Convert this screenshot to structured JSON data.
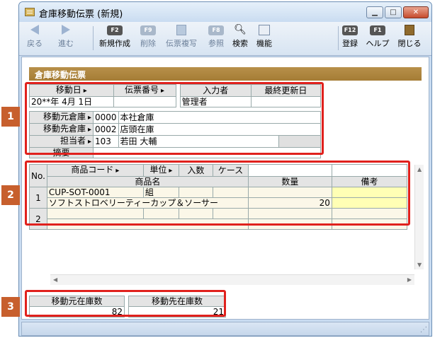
{
  "window": {
    "title": "倉庫移動伝票 (新規)",
    "min": "▁",
    "max": "□",
    "close": "✕"
  },
  "toolbar": {
    "back": "戻る",
    "forward": "進む",
    "new": {
      "key": "F2",
      "label": "新規作成"
    },
    "delete": {
      "key": "F9",
      "label": "削除"
    },
    "copy": {
      "label": "伝票複写"
    },
    "ref": {
      "key": "F8",
      "label": "参照"
    },
    "search": {
      "label": "検索"
    },
    "func": {
      "label": "機能"
    },
    "register": {
      "key": "F12",
      "label": "登録"
    },
    "help": {
      "key": "F1",
      "label": "ヘルプ"
    },
    "close": {
      "label": "閉じる"
    }
  },
  "doc": {
    "header": "倉庫移動伝票"
  },
  "section1": {
    "move_date_label": "移動日",
    "slip_no_label": "伝票番号",
    "entered_by_label": "入力者",
    "last_update_label": "最終更新日",
    "move_date_value": "20**年 4月 1日",
    "slip_no_value": "",
    "entered_by_value": "管理者",
    "last_update_value": "",
    "from_wh_label": "移動元倉庫",
    "from_wh_code": "0000",
    "from_wh_name": "本社倉庫",
    "to_wh_label": "移動先倉庫",
    "to_wh_code": "0002",
    "to_wh_name": "店頭在庫",
    "staff_label": "担当者",
    "staff_code": "103",
    "staff_name": "若田 大輔",
    "memo_label": "摘要",
    "memo_value": ""
  },
  "section2": {
    "h_no": "No.",
    "h_code": "商品コード",
    "h_unit": "単位",
    "h_count": "入数",
    "h_case": "ケース",
    "h_name": "商品名",
    "h_qty": "数量",
    "h_note": "備考",
    "rows": [
      {
        "no": "1",
        "code": "CUP-SOT-0001",
        "unit": "組",
        "name": "ソフトストロベリーティーカップ＆ソーサー",
        "qty": "20",
        "note": ""
      },
      {
        "no": "2",
        "code": "",
        "unit": "",
        "name": "",
        "qty": "",
        "note": ""
      }
    ]
  },
  "section3": {
    "from_stock_label": "移動元在庫数",
    "to_stock_label": "移動先在庫数",
    "from_stock_value": "82",
    "to_stock_value": "21"
  },
  "badges": [
    "1",
    "2",
    "3"
  ],
  "colors": {
    "accent_header": "#a57c35",
    "annotation_red": "#e0211d",
    "badge": "#c75f2d",
    "note_cell": "#ffffb5"
  }
}
